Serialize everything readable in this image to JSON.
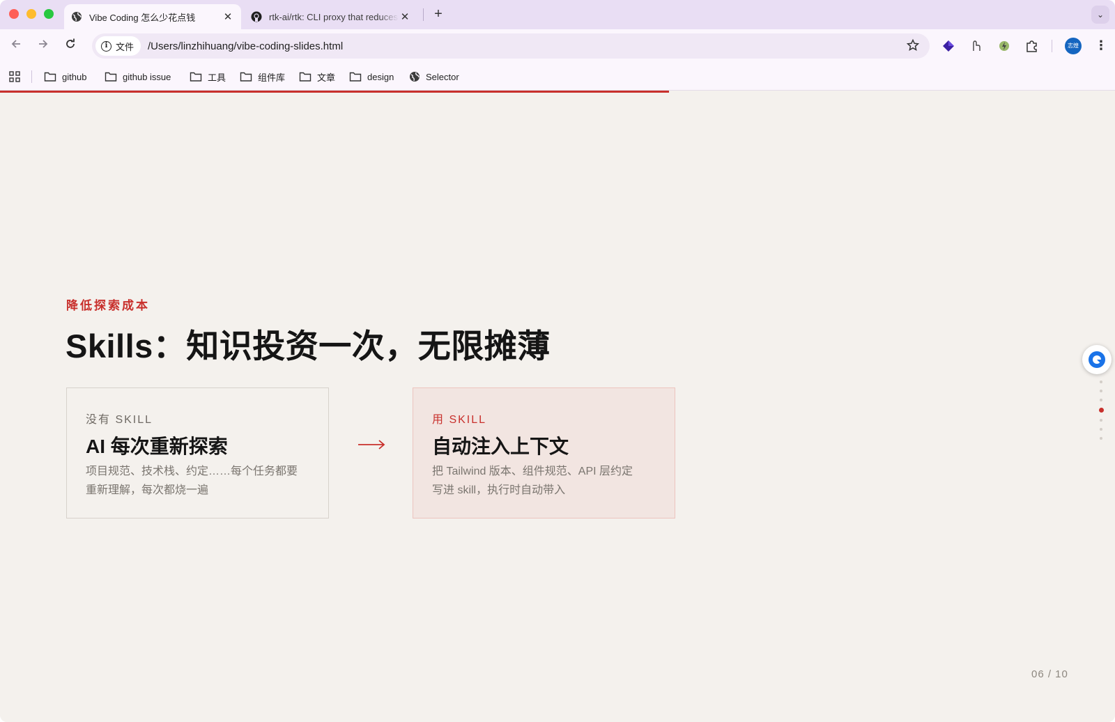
{
  "browser": {
    "tabs": [
      {
        "title": "Vibe Coding 怎么少花点钱",
        "close": "✕"
      },
      {
        "title": "rtk-ai/rtk: CLI proxy that reduces",
        "close": "✕"
      }
    ],
    "new_tab": "+",
    "tab_menu": "⌄",
    "site_chip": "文件",
    "url": "/Users/linzhihuang/vibe-coding-slides.html",
    "profile": "志煌",
    "bookmarks": [
      "github",
      "github issue",
      "工具",
      "组件库",
      "文章",
      "design",
      "Selector"
    ]
  },
  "slide": {
    "eyebrow": "降低探索成本",
    "headline": "Skills：知识投资一次，无限摊薄",
    "card_without": {
      "label": "没有 SKILL",
      "title": "AI 每次重新探索",
      "desc_line1": "项目规范、技术栈、约定……每个任务都要",
      "desc_line2": "重新理解，每次都烧一遍"
    },
    "card_with": {
      "label": "用 SKILL",
      "title": "自动注入上下文",
      "desc_line1": "把 Tailwind 版本、组件规范、API 层约定",
      "desc_line2": "写进 skill，执行时自动带入"
    },
    "arrow": "→",
    "pager": "06 / 10",
    "progress": 0.6,
    "accent_color": "#c8302c"
  }
}
